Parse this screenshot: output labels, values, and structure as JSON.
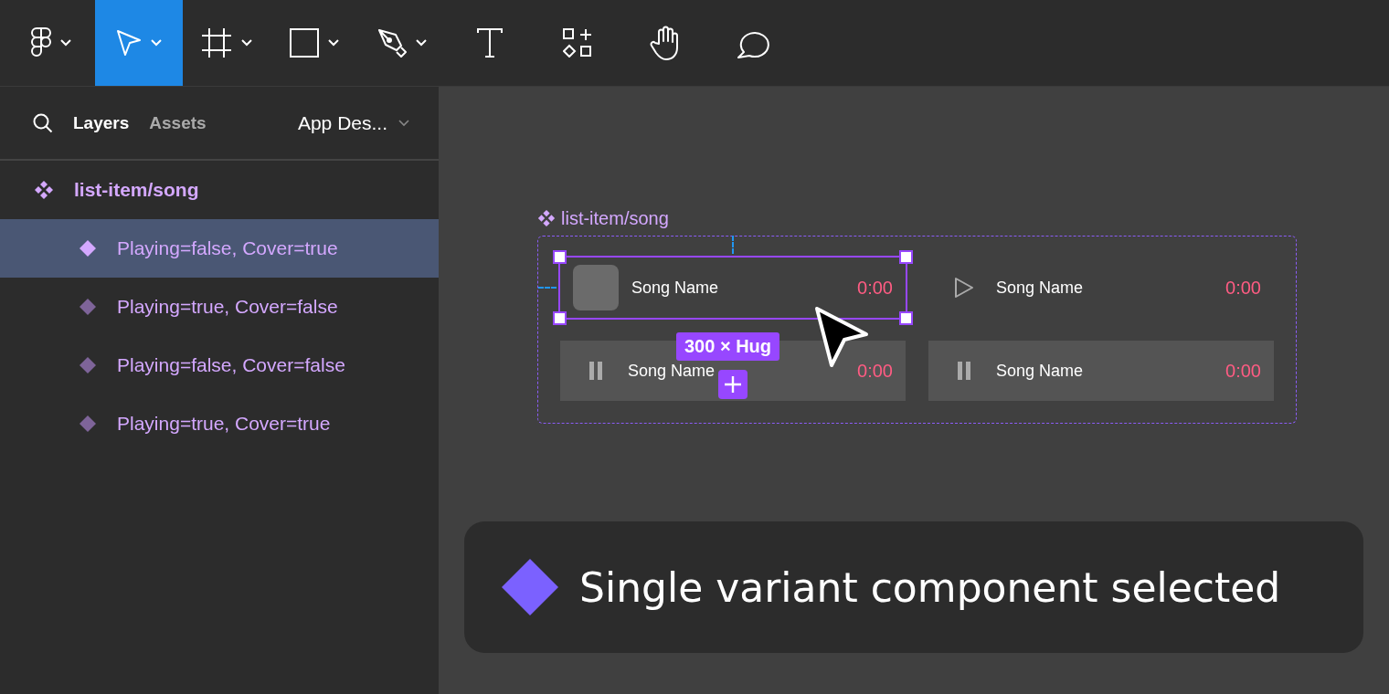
{
  "toolbar": {
    "tools": [
      {
        "kind": "logo",
        "dropdown": true,
        "selected": false
      },
      {
        "kind": "move",
        "dropdown": true,
        "selected": true
      },
      {
        "kind": "frame",
        "dropdown": true,
        "selected": false
      },
      {
        "kind": "rectangle",
        "dropdown": true,
        "selected": false
      },
      {
        "kind": "pen",
        "dropdown": true,
        "selected": false
      },
      {
        "kind": "text",
        "dropdown": false,
        "selected": false
      },
      {
        "kind": "resources",
        "dropdown": false,
        "selected": false
      },
      {
        "kind": "hand",
        "dropdown": false,
        "selected": false
      },
      {
        "kind": "comment",
        "dropdown": false,
        "selected": false
      }
    ]
  },
  "panel": {
    "tabs": [
      {
        "label": "Layers",
        "selected": true
      },
      {
        "label": "Assets",
        "selected": false
      }
    ],
    "page": "App Des...",
    "layers": [
      {
        "label": "list-item/song",
        "children": [
          {
            "label": "Playing=false, Cover=true",
            "selected": true
          },
          {
            "label": "Playing=true, Cover=false",
            "selected": false
          },
          {
            "label": "Playing=false, Cover=false",
            "selected": false
          },
          {
            "label": "Playing=true, Cover=true",
            "selected": false
          }
        ]
      }
    ]
  },
  "canvas": {
    "frame_label": "list-item/song",
    "variants": [
      {
        "kind": "cover",
        "name": "Song Name",
        "time": "0:00",
        "selected": true,
        "highlighted": false
      },
      {
        "kind": "play",
        "name": "Song Name",
        "time": "0:00",
        "selected": false,
        "highlighted": false
      },
      {
        "kind": "pause",
        "name": "Song Name",
        "time": "0:00",
        "selected": false,
        "highlighted": true
      },
      {
        "kind": "pause",
        "name": "Song Name",
        "time": "0:00",
        "selected": false,
        "highlighted": true
      }
    ],
    "size_badge": "300 × Hug"
  },
  "toast": {
    "text": "Single variant component selected"
  }
}
